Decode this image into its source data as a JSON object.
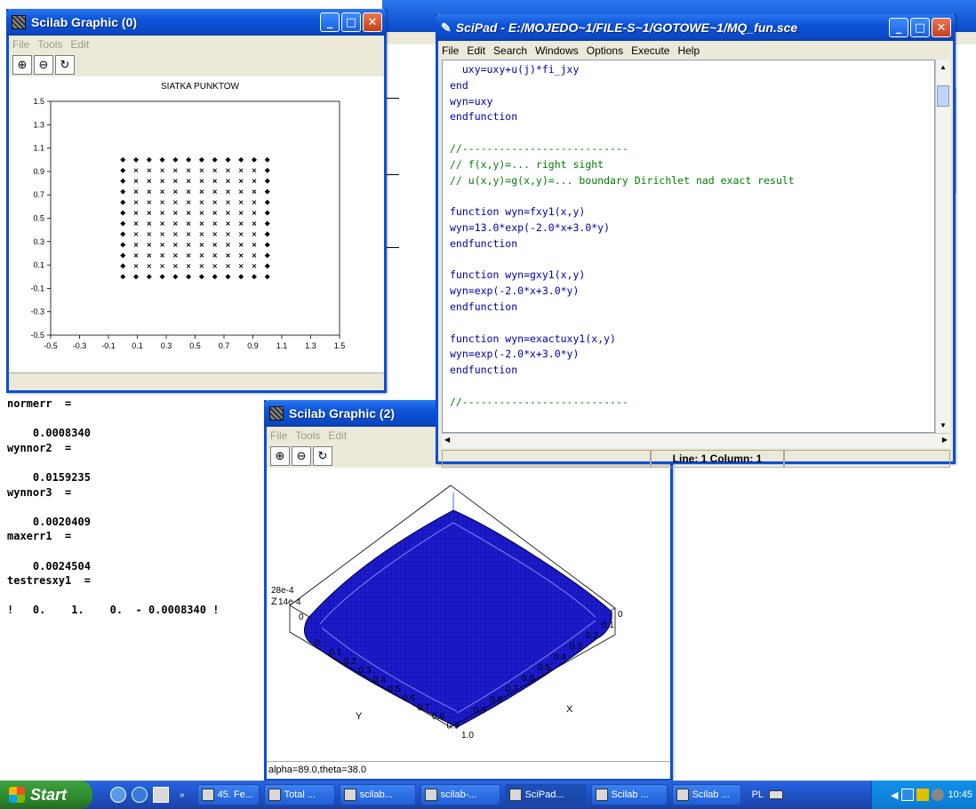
{
  "console": {
    "lines": [
      "normerr  =",
      "",
      "    0.0008340",
      "wynnor2  =",
      "",
      "    0.0159235",
      "wynnor3  =",
      "",
      "    0.0020409",
      "maxerr1  =",
      "",
      "    0.0024504",
      "testresxy1  =",
      "",
      "!   0.    1.    0.  - 0.0008340 !"
    ]
  },
  "graphic0": {
    "title": "Scilab Graphic (0)",
    "menu": [
      "File",
      "Tools",
      "Edit"
    ],
    "plot_title": "SIATKA PUNKTOW"
  },
  "graphic2": {
    "title": "Scilab Graphic (2)",
    "menu": [
      "File",
      "Tools",
      "Edit"
    ],
    "status": "alpha=89.0,theta=38.0",
    "z_label": "Z",
    "z_ticks": [
      "28e-4",
      "14e-4",
      "0"
    ],
    "x_label": "X",
    "y_label": "Y",
    "y_ticks": [
      "0",
      "0.1",
      "0.2",
      "0.3",
      "0.4",
      "0.5",
      "0.6",
      "0.7",
      "0.8",
      "0.9",
      "1.0"
    ],
    "x_ticks": [
      "0",
      "0.1",
      "0.2",
      "0.3",
      "0.4",
      "0.5",
      "0.6",
      "0.7",
      "0.8",
      "0.9"
    ]
  },
  "scipad": {
    "title": "SciPad - E:/MOJEDO~1/FILE-S~1/GOTOWE~1/MQ_fun.sce",
    "menu": [
      "File",
      "Edit",
      "Search",
      "Windows",
      "Options",
      "Execute",
      "Help"
    ],
    "status_line": "Line: 1  Column: 1",
    "code": [
      "  uxy=uxy+u(j)*fi_jxy",
      "end",
      "wyn=uxy",
      "endfunction",
      "",
      "//---------------------------",
      "// f(x,y)=... right sight",
      "// u(x,y)=g(x,y)=... boundary Dirichlet nad exact result",
      "",
      "function wyn=fxy1(x,y)",
      "wyn=13.0*exp(-2.0*x+3.0*y)",
      "endfunction",
      "",
      "function wyn=gxy1(x,y)",
      "wyn=exp(-2.0*x+3.0*y)",
      "endfunction",
      "",
      "function wyn=exactuxy1(x,y)",
      "wyn=exp(-2.0*x+3.0*y)",
      "endfunction",
      "",
      "//---------------------------"
    ]
  },
  "taskbar": {
    "start": "Start",
    "tasks": [
      "45. Fe...",
      "Total ...",
      "scilab...",
      "scilab-...",
      "SciPad...",
      "Scilab ...",
      "Scilab ..."
    ],
    "lang": "PL",
    "clock": "10:45"
  },
  "chart_data": {
    "type": "scatter",
    "title": "SIATKA PUNKTOW",
    "xlim": [
      -0.5,
      1.5
    ],
    "ylim": [
      -0.5,
      1.5
    ],
    "x_ticks": [
      "-0.5",
      "-0.3",
      "-0.1",
      "0.1",
      "0.3",
      "0.5",
      "0.7",
      "0.9",
      "1.1",
      "1.3",
      "1.5"
    ],
    "y_ticks": [
      "1.5",
      "1.3",
      "1.1",
      "0.9",
      "0.7",
      "0.5",
      "0.3",
      "0.1",
      "-0.1",
      "-0.3",
      "-0.5"
    ],
    "grid_n": 12,
    "grid_range": [
      0.0,
      1.0
    ],
    "series": [
      {
        "marker": "diamond",
        "role": "boundary"
      },
      {
        "marker": "x",
        "role": "interior"
      }
    ],
    "grid": false
  }
}
